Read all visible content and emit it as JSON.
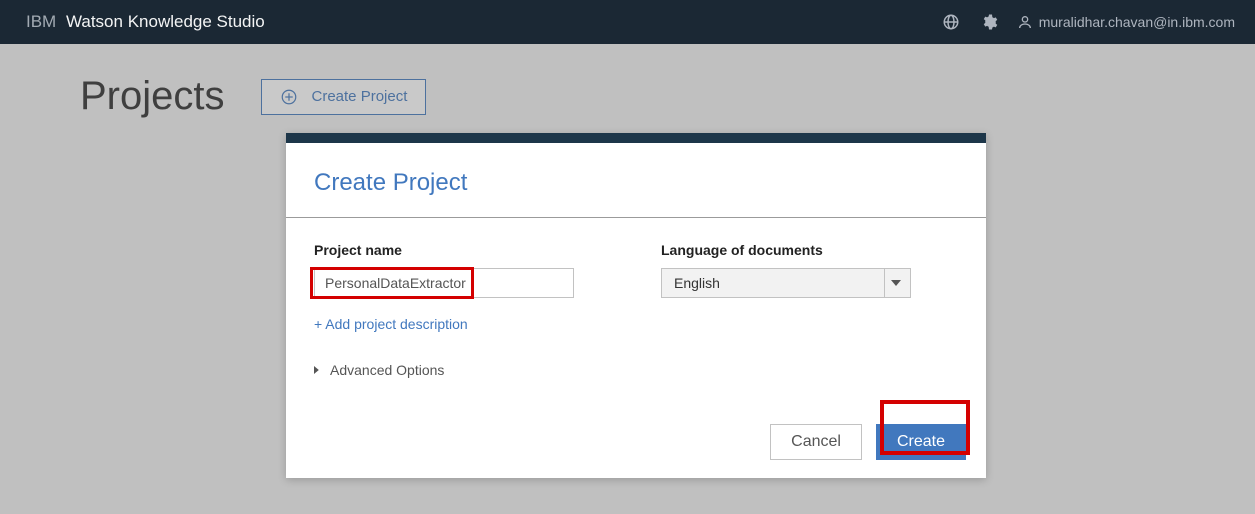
{
  "header": {
    "brand_prefix": "IBM",
    "brand_product": "Watson Knowledge Studio",
    "user_email": "muralidhar.chavan@in.ibm.com"
  },
  "page": {
    "title": "Projects",
    "create_button": "Create Project"
  },
  "modal": {
    "title": "Create Project",
    "project_name_label": "Project name",
    "project_name_value": "PersonalDataExtractor",
    "language_label": "Language of documents",
    "language_value": "English",
    "add_description_link": "+ Add project description",
    "advanced_options": "Advanced Options",
    "cancel": "Cancel",
    "create": "Create"
  }
}
